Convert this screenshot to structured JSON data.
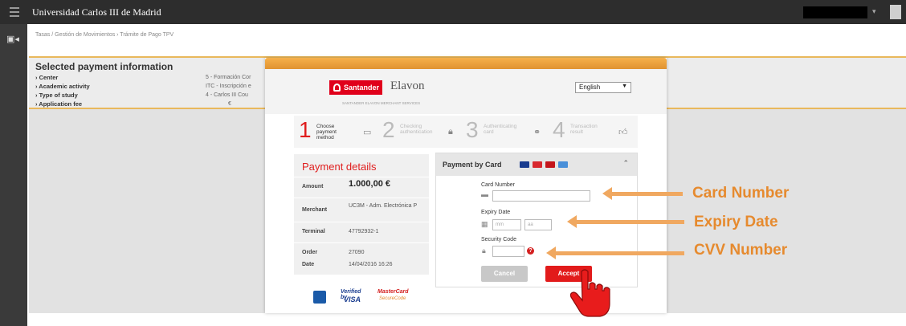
{
  "topbar": {
    "title": "Universidad Carlos III de Madrid"
  },
  "breadcrumb": "Tasas  /  Gestión de Movimientos › Trámite de Pago TPV",
  "info": {
    "heading": "Selected payment information",
    "rows": [
      {
        "label": "› Center",
        "value": "5 - Formación Cor"
      },
      {
        "label": "› Academic activity",
        "value": "ITC - Inscripción e"
      },
      {
        "label": "› Type of study",
        "value": "4 - Carlos III Cou"
      },
      {
        "label": "› Application fee",
        "value": "€"
      }
    ]
  },
  "modal": {
    "brand_santander": "Santander",
    "brand_elavon": "Elavon",
    "brand_tagline": "SANTANDER ELAVON MERCHANT SERVICES",
    "language": "English",
    "steps": [
      {
        "num": "1",
        "text": "Choose\npayment\nmethod"
      },
      {
        "num": "2",
        "text": "Checking\nauthentication"
      },
      {
        "num": "3",
        "text": "Authenticating\ncard"
      },
      {
        "num": "4",
        "text": "Transaction\nresult"
      }
    ],
    "payment_details": {
      "heading": "Payment details",
      "rows": [
        {
          "key": "Amount",
          "value": "1.000,00  €"
        },
        {
          "key": "Merchant",
          "value": "UC3M - Adm. Electrónica P"
        },
        {
          "key": "Terminal",
          "value": "47792932-1"
        },
        {
          "key": "Order",
          "value": "27090"
        },
        {
          "key": "Date",
          "value": "14/04/2016   16:26"
        }
      ]
    },
    "card": {
      "heading": "Payment by Card",
      "card_number_label": "Card Number",
      "expiry_label": "Expiry Date",
      "mm_placeholder": "mm",
      "aa_placeholder": "aa",
      "security_label": "Security Code",
      "cancel": "Cancel",
      "accept": "Accept"
    },
    "footer_logos": {
      "verified": "Verified by",
      "visa": "VISA",
      "mastercard": "MasterCard",
      "securecode": "SecureCode"
    }
  },
  "annotations": {
    "card_number": "Card Number",
    "expiry": "Expiry Date",
    "cvv": "CVV Number"
  },
  "colors": {
    "accent_orange": "#e68a2e",
    "santander_red": "#e0001b",
    "accept_red": "#e21b1b"
  }
}
